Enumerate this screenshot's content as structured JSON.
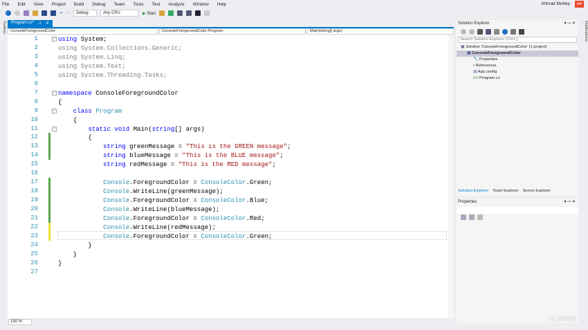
{
  "menu": [
    "File",
    "Edit",
    "View",
    "Project",
    "Build",
    "Debug",
    "Team",
    "Tools",
    "Test",
    "Analyze",
    "Window",
    "Help"
  ],
  "user": {
    "name": "Ahmad Mohey",
    "initials": "AM"
  },
  "toolbar": {
    "config": "Debug",
    "platform": "Any CPU",
    "start": "Start"
  },
  "toolbox_label": "Toolbox",
  "notifications_label": "Notifications",
  "tab": {
    "label": "Program.cs*"
  },
  "nav": {
    "project": "ConsoleForegroundColor",
    "class": "ConsoleForegroundColor.Program",
    "member": "Main(string[] args)"
  },
  "zoom": "150 %",
  "colors": {
    "keyword": "#0000ff",
    "type": "#2b91af",
    "string": "#a31515",
    "accent": "#007acc"
  },
  "code": [
    [
      [
        "using",
        "kw"
      ],
      [
        " System;",
        "pl"
      ]
    ],
    [
      [
        "using System.Collections.Generic;",
        "gr"
      ]
    ],
    [
      [
        "using System.Linq;",
        "gr"
      ]
    ],
    [
      [
        "using System.Text;",
        "gr"
      ]
    ],
    [
      [
        "using System.Threading.Tasks;",
        "gr"
      ]
    ],
    [],
    [
      [
        "namespace",
        "kw"
      ],
      [
        " ConsoleForegroundColor",
        "pl"
      ]
    ],
    [
      [
        "{",
        "pl"
      ]
    ],
    [
      [
        "    ",
        "pl"
      ],
      [
        "class",
        "kw"
      ],
      [
        " ",
        "pl"
      ],
      [
        "Program",
        "ty"
      ]
    ],
    [
      [
        "    {",
        "pl"
      ]
    ],
    [
      [
        "        ",
        "pl"
      ],
      [
        "static void",
        "kw"
      ],
      [
        " Main(",
        "pl"
      ],
      [
        "string",
        "kw"
      ],
      [
        "[] args)",
        "pl"
      ]
    ],
    [
      [
        "        {",
        "pl"
      ]
    ],
    [
      [
        "            ",
        "pl"
      ],
      [
        "string",
        "kw"
      ],
      [
        " greenMessage = ",
        "pl"
      ],
      [
        "\"This is the GREEN message\"",
        "st"
      ],
      [
        ";",
        "pl"
      ]
    ],
    [
      [
        "            ",
        "pl"
      ],
      [
        "string",
        "kw"
      ],
      [
        " blueMessage = ",
        "pl"
      ],
      [
        "\"This is the BLUE message\"",
        "st"
      ],
      [
        ";",
        "pl"
      ]
    ],
    [
      [
        "            ",
        "pl"
      ],
      [
        "string",
        "kw"
      ],
      [
        " redMessage = ",
        "pl"
      ],
      [
        "\"This is the RED message\"",
        "st"
      ],
      [
        ";",
        "pl"
      ]
    ],
    [],
    [
      [
        "            ",
        "pl"
      ],
      [
        "Console",
        "ty"
      ],
      [
        ".ForegroundColor = ",
        "pl"
      ],
      [
        "ConsoleColor",
        "ty"
      ],
      [
        ".Green;",
        "pl"
      ]
    ],
    [
      [
        "            ",
        "pl"
      ],
      [
        "Console",
        "ty"
      ],
      [
        ".WriteLine(greenMessage);",
        "pl"
      ]
    ],
    [
      [
        "            ",
        "pl"
      ],
      [
        "Console",
        "ty"
      ],
      [
        ".ForegroundColor = ",
        "pl"
      ],
      [
        "ConsoleColor",
        "ty"
      ],
      [
        ".Blue;",
        "pl"
      ]
    ],
    [
      [
        "            ",
        "pl"
      ],
      [
        "Console",
        "ty"
      ],
      [
        ".WriteLine(blueMessage);",
        "pl"
      ]
    ],
    [
      [
        "            ",
        "pl"
      ],
      [
        "Console",
        "ty"
      ],
      [
        ".ForegroundColor = ",
        "pl"
      ],
      [
        "ConsoleColor",
        "ty"
      ],
      [
        ".Red;",
        "pl"
      ]
    ],
    [
      [
        "            ",
        "pl"
      ],
      [
        "Console",
        "ty"
      ],
      [
        ".WriteLine(redMessage);",
        "pl"
      ]
    ],
    [
      [
        "            ",
        "pl"
      ],
      [
        "Console",
        "ty"
      ],
      [
        ".ForegroundColor = ",
        "pl"
      ],
      [
        "ConsoleColor",
        "ty"
      ],
      [
        ".Green;",
        "pl"
      ]
    ],
    [
      [
        "        }",
        "pl"
      ]
    ],
    [
      [
        "    }",
        "pl"
      ]
    ],
    [
      [
        "}",
        "pl"
      ]
    ],
    []
  ],
  "solution_explorer": {
    "title": "Solution Explorer",
    "search_placeholder": "Search Solution Explorer (Ctrl+;)",
    "items": [
      {
        "label": "Solution 'ConsoleForegroundColor' (1 project)",
        "level": 0
      },
      {
        "label": "ConsoleForegroundColor",
        "level": 1,
        "selected": true
      },
      {
        "label": "Properties",
        "level": 2
      },
      {
        "label": "References",
        "level": 2
      },
      {
        "label": "App.config",
        "level": 2
      },
      {
        "label": "Program.cs",
        "level": 2
      }
    ],
    "tabs": [
      "Solution Explorer",
      "Team Explorer",
      "Server Explorer"
    ]
  },
  "properties": {
    "title": "Properties"
  },
  "watermark": "Udemy"
}
